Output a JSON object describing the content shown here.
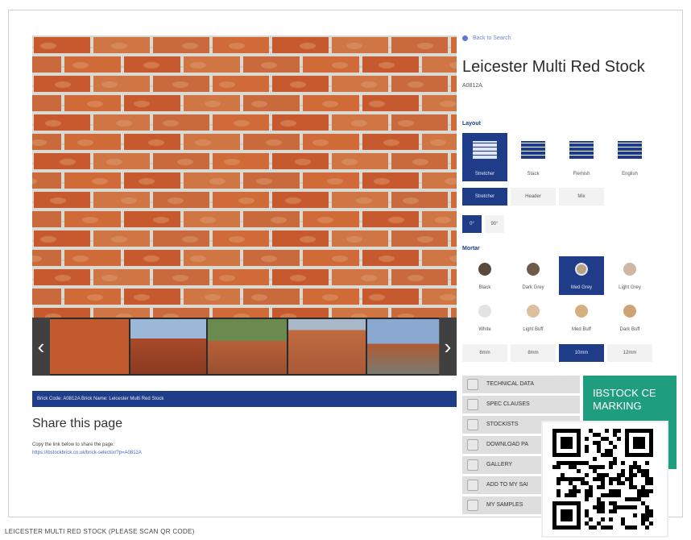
{
  "back_link": "Back to Search",
  "product": {
    "title": "Leicester Multi Red Stock",
    "code": "A0812A"
  },
  "layout": {
    "heading": "Layout",
    "bonds": [
      {
        "label": "Stretcher",
        "selected": true
      },
      {
        "label": "Stack",
        "selected": false
      },
      {
        "label": "Flemish",
        "selected": false
      },
      {
        "label": "English",
        "selected": false
      }
    ],
    "orientation": [
      {
        "label": "Stretcher",
        "selected": true
      },
      {
        "label": "Header",
        "selected": false
      },
      {
        "label": "Mix",
        "selected": false
      }
    ],
    "angle": [
      {
        "label": "0°",
        "selected": true
      },
      {
        "label": "90°",
        "selected": false
      }
    ]
  },
  "mortar": {
    "heading": "Mortar",
    "colors": [
      {
        "label": "Black",
        "hex": "#5a4a3e",
        "selected": false
      },
      {
        "label": "Dark Grey",
        "hex": "#6e5a48",
        "selected": false
      },
      {
        "label": "Med Grey",
        "hex": "#b8a282",
        "selected": true
      },
      {
        "label": "Light Grey",
        "hex": "#cdb8a3",
        "selected": false
      },
      {
        "label": "White",
        "hex": "#e3e3e3",
        "selected": false
      },
      {
        "label": "Light Buff",
        "hex": "#dcc0a0",
        "selected": false
      },
      {
        "label": "Med Buff",
        "hex": "#d6b07c",
        "selected": false
      },
      {
        "label": "Dark Buff",
        "hex": "#cfa474",
        "selected": false
      }
    ],
    "joints": [
      {
        "label": "6mm",
        "selected": false
      },
      {
        "label": "8mm",
        "selected": false
      },
      {
        "label": "10mm",
        "selected": true
      },
      {
        "label": "12mm",
        "selected": false
      }
    ]
  },
  "brick_bar": "Brick Code: A0812A Brick Name: Leicester Multi Red Stock",
  "share": {
    "title": "Share this page",
    "text": "Copy the link below to share the page:",
    "link": "https://ibstockbrick.co.uk/brick-selector/?p=A0812A"
  },
  "actions": [
    "TECHNICAL DATA",
    "SPEC CLAUSES",
    "STOCKISTS",
    "DOWNLOAD PA",
    "GALLERY",
    "ADD TO MY SAI",
    "MY SAMPLES"
  ],
  "ce_marking": "IBSTOCK CE MARKING",
  "caption": "LEICESTER MULTI RED STOCK (PLEASE SCAN QR CODE)",
  "colors": {
    "accent": "#1f3c88",
    "ce": "#1f9e7f",
    "brick": "#c85a2c"
  }
}
